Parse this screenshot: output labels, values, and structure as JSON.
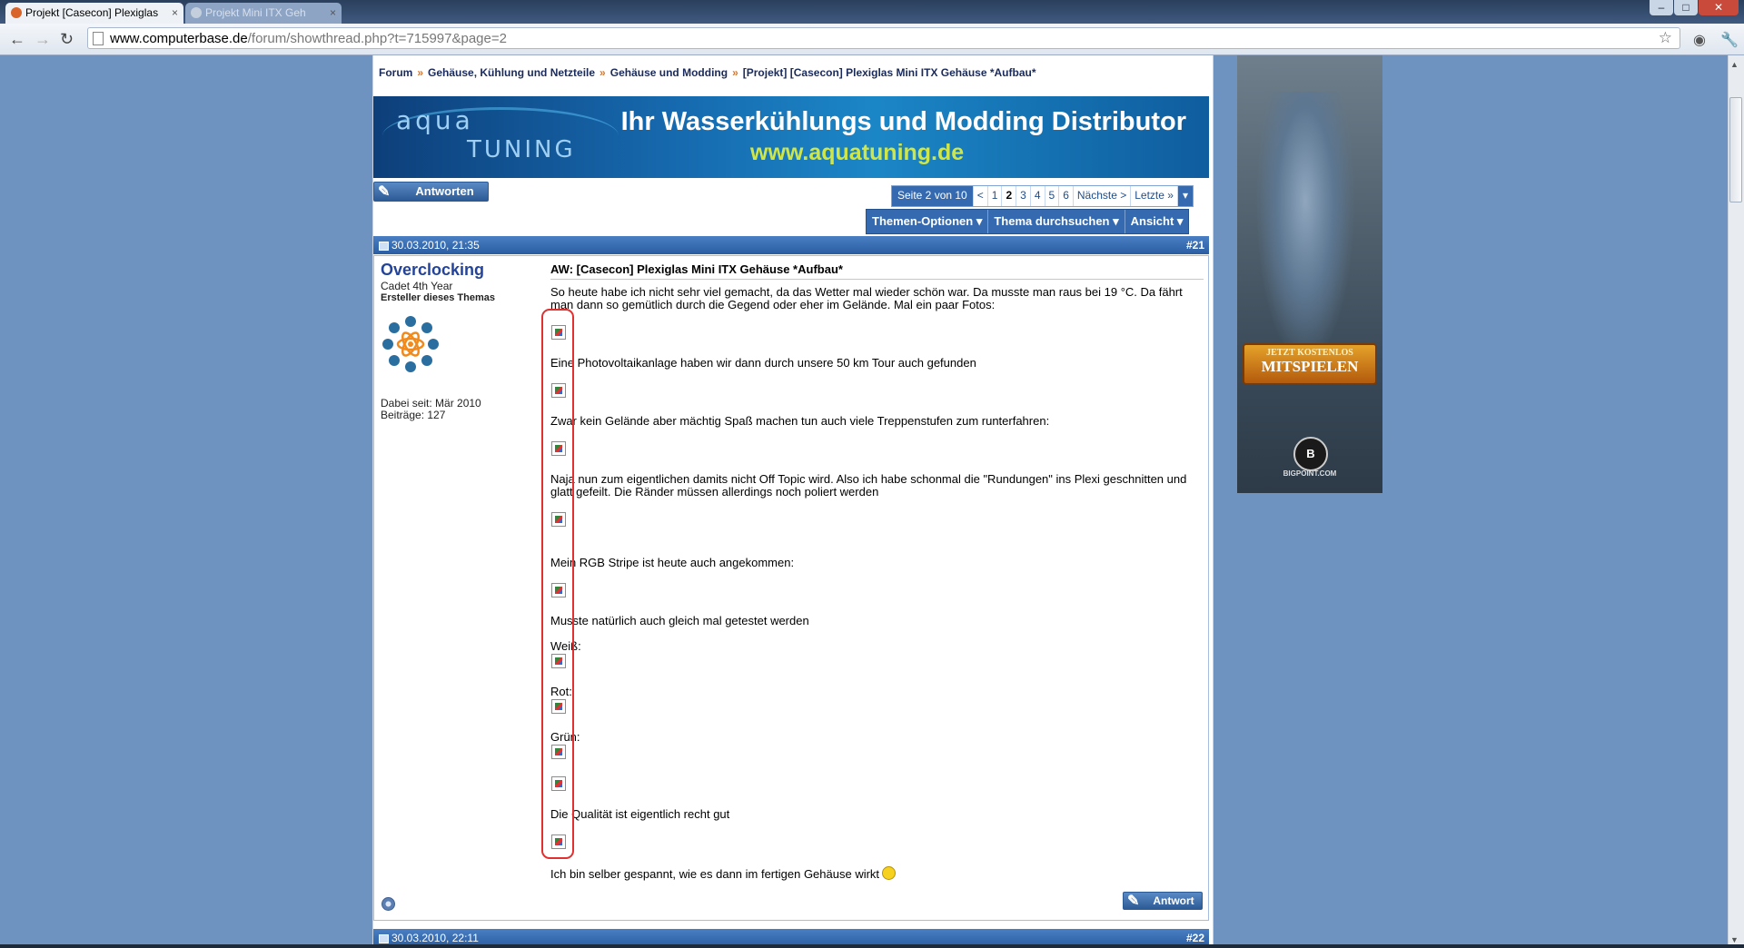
{
  "browser": {
    "tabs": [
      {
        "label": "Projekt [Casecon] Plexiglas"
      },
      {
        "label": "Projekt Mini ITX Geh"
      }
    ],
    "url_host": "www.computerbase.de",
    "url_path": "/forum/showthread.php?t=715997&page=2"
  },
  "breadcrumb": {
    "items": [
      "Forum",
      "Gehäuse, Kühlung und Netzteile",
      "Gehäuse und Modding",
      "[Projekt] [Casecon] Plexiglas Mini ITX Gehäuse *Aufbau*"
    ],
    "separator": "»"
  },
  "banner": {
    "logo_line1": "aqua",
    "logo_line2": "TUNING",
    "title": "Ihr Wasserkühlungs und Modding Distributor",
    "url": "www.aquatuning.de"
  },
  "toolbar": {
    "reply_label": "Antworten",
    "reply_small_label": "Antwort"
  },
  "pagination": {
    "label": "Seite 2 von 10",
    "prev": "<",
    "pages": [
      "1",
      "2",
      "3",
      "4",
      "5",
      "6"
    ],
    "current": "2",
    "next": "Nächste >",
    "last": "Letzte »",
    "drop": "▾"
  },
  "thread_tools": {
    "options": "Themen-Optionen ▾",
    "search": "Thema durchsuchen ▾",
    "view": "Ansicht ▾"
  },
  "post": {
    "date": "30.03.2010, 21:35",
    "number": "#21",
    "username": "Overclocking",
    "user_title": "Cadet 4th Year",
    "user_rank": "Ersteller dieses Themas",
    "join_date": "Dabei seit: Mär 2010",
    "post_count": "Beiträge: 127",
    "title": "AW: [Casecon] Plexiglas Mini ITX Gehäuse *Aufbau*",
    "paragraphs": {
      "p1": "So heute habe ich nicht sehr viel gemacht, da das Wetter mal wieder schön war. Da musste man raus bei 19 °C. Da fährt man dann so gemütlich durch die Gegend oder eher im Gelände. Mal ein paar Fotos:",
      "p2": "Eine Photovoltaikanlage haben wir dann durch unsere 50 km Tour auch gefunden",
      "p3": "Zwar kein Gelände aber mächtig Spaß machen tun auch viele Treppenstufen zum runterfahren:",
      "p4": "Naja nun zum eigentlichen damits nicht Off Topic wird. Also ich habe schonmal die \"Rundungen\" ins Plexi geschnitten und glatt gefeilt. Die Ränder müssen allerdings noch poliert werden",
      "p5": "Mein RGB Stripe ist heute auch angekommen:",
      "p6": "Musste natürlich auch gleich mal getestet werden",
      "p7": "Weiß:",
      "p8": "Rot:",
      "p9": "Grün:",
      "p10": "Die Qualität ist eigentlich recht gut",
      "p11": "Ich bin selber gespannt, wie es dann im fertigen Gehäuse wirkt"
    }
  },
  "next_post": {
    "date": "30.03.2010, 22:11",
    "number": "#22"
  },
  "ad": {
    "button_line1": "JETZT KOSTENLOS",
    "button_line2": "MITSPIELEN",
    "logo_letter": "B",
    "logo_text": "BIGPOINT.COM"
  },
  "colors": {
    "accent": "#356ab0",
    "highlight_box": "#e03030",
    "page_bg": "#6e93c0"
  }
}
